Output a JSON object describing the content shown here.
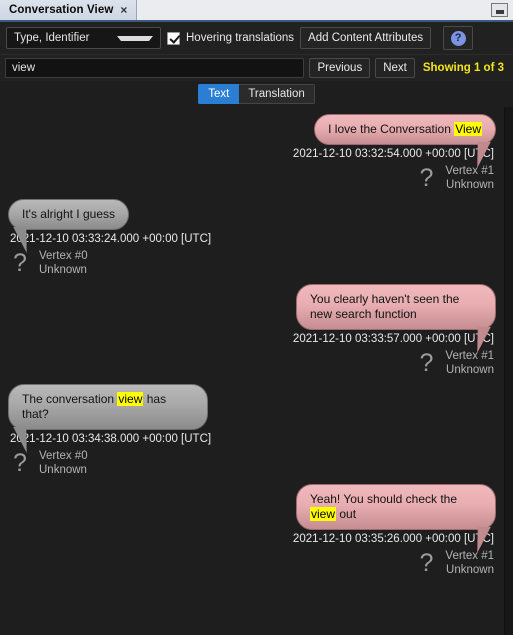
{
  "window": {
    "tab_title": "Conversation View",
    "tab_close_glyph": "×",
    "minimize_label": ""
  },
  "toolbar": {
    "combo_value": "Type, Identifier",
    "hovering_translations_label": "Hovering translations",
    "add_content_attributes_label": "Add Content Attributes",
    "help_glyph": "?"
  },
  "search": {
    "value": "view",
    "placeholder": "Search",
    "previous_label": "Previous",
    "next_label": "Next",
    "showing_label": "Showing 1 of 3",
    "showing_color": "#f2e51c"
  },
  "view_tabs": {
    "text_label": "Text",
    "translation_label": "Translation",
    "active": "Text",
    "active_color": "#2a7fd4"
  },
  "colors": {
    "pink_bubble": "#e8adb0",
    "gray_bubble": "#a8a8a8",
    "highlight": "#ffff00",
    "background": "#1e1e1e"
  },
  "messages": [
    {
      "side": "right",
      "style": "pink",
      "text_before": "I love the Conversation ",
      "highlight": "View",
      "text_after": "",
      "timestamp": "2021-12-10 03:32:54.000 +00:00 [UTC]",
      "vertex": "Vertex #1",
      "status": "Unknown",
      "avatar_glyph": "?"
    },
    {
      "side": "left",
      "style": "gray",
      "text_before": "It's alright I guess",
      "highlight": "",
      "text_after": "",
      "timestamp": "2021-12-10 03:33:24.000 +00:00 [UTC]",
      "vertex": "Vertex #0",
      "status": "Unknown",
      "avatar_glyph": "?"
    },
    {
      "side": "right",
      "style": "pink",
      "text_before": "You clearly haven't seen the new search function",
      "highlight": "",
      "text_after": "",
      "timestamp": "2021-12-10 03:33:57.000 +00:00 [UTC]",
      "vertex": "Vertex #1",
      "status": "Unknown",
      "avatar_glyph": "?"
    },
    {
      "side": "left",
      "style": "gray",
      "text_before": "The conversation ",
      "highlight": "view",
      "text_after": " has that?",
      "timestamp": "2021-12-10 03:34:38.000 +00:00 [UTC]",
      "vertex": "Vertex #0",
      "status": "Unknown",
      "avatar_glyph": "?"
    },
    {
      "side": "right",
      "style": "pink",
      "text_before": "Yeah! You should check the ",
      "highlight": "view",
      "text_after": " out",
      "timestamp": "2021-12-10 03:35:26.000 +00:00 [UTC]",
      "vertex": "Vertex #1",
      "status": "Unknown",
      "avatar_glyph": "?"
    }
  ]
}
